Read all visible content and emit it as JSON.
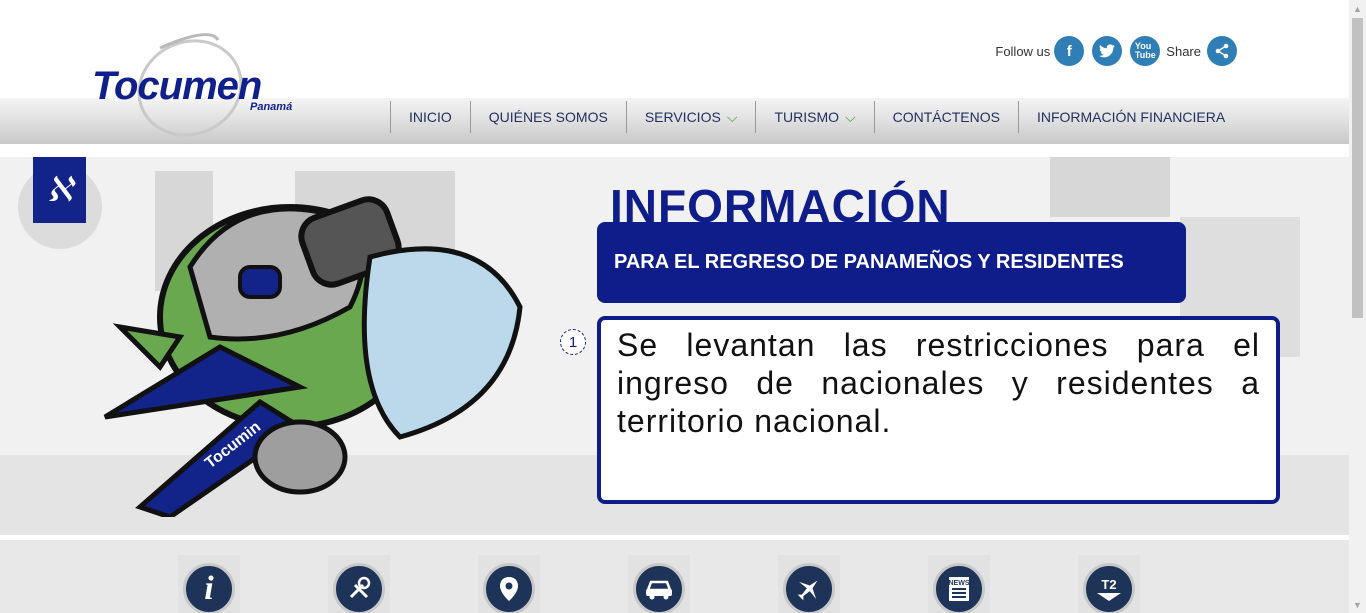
{
  "header": {
    "logo": {
      "name": "Tocumen",
      "sub": "Panamá"
    },
    "social": {
      "follow_label": "Follow us",
      "share_label": "Share",
      "icons": [
        "facebook-icon",
        "twitter-icon",
        "youtube-icon",
        "share-icon"
      ]
    },
    "menu": [
      {
        "label": "INICIO",
        "dropdown": false
      },
      {
        "label": "QUIÉNES SOMOS",
        "dropdown": false
      },
      {
        "label": "SERVICIOS",
        "dropdown": true
      },
      {
        "label": "TURISMO",
        "dropdown": true
      },
      {
        "label": "CONTÁCTENOS",
        "dropdown": false
      },
      {
        "label": "INFORMACIÓN FINANCIERA",
        "dropdown": false
      }
    ]
  },
  "hero": {
    "title": "INFORMACIÓN",
    "subtitle": "PARA EL REGRESO DE PANAMEÑOS Y RESIDENTES",
    "slide_number": "1",
    "message": "Se levantan las restricciones para el ingreso de nacionales y residentes a territorio nacional.",
    "mascot_label": "Tocumin"
  },
  "quick_links": [
    {
      "icon": "info-icon",
      "glyph": "i"
    },
    {
      "icon": "food-icon",
      "glyph": ""
    },
    {
      "icon": "location-icon",
      "glyph": ""
    },
    {
      "icon": "car-icon",
      "glyph": ""
    },
    {
      "icon": "plane-icon",
      "glyph": ""
    },
    {
      "icon": "news-icon",
      "glyph": "NEWS"
    },
    {
      "icon": "terminal-icon",
      "glyph": "T2"
    }
  ],
  "colors": {
    "brand": "#0e1d8a",
    "social": "#2f7fb6",
    "accent_green": "#3aa34a"
  }
}
